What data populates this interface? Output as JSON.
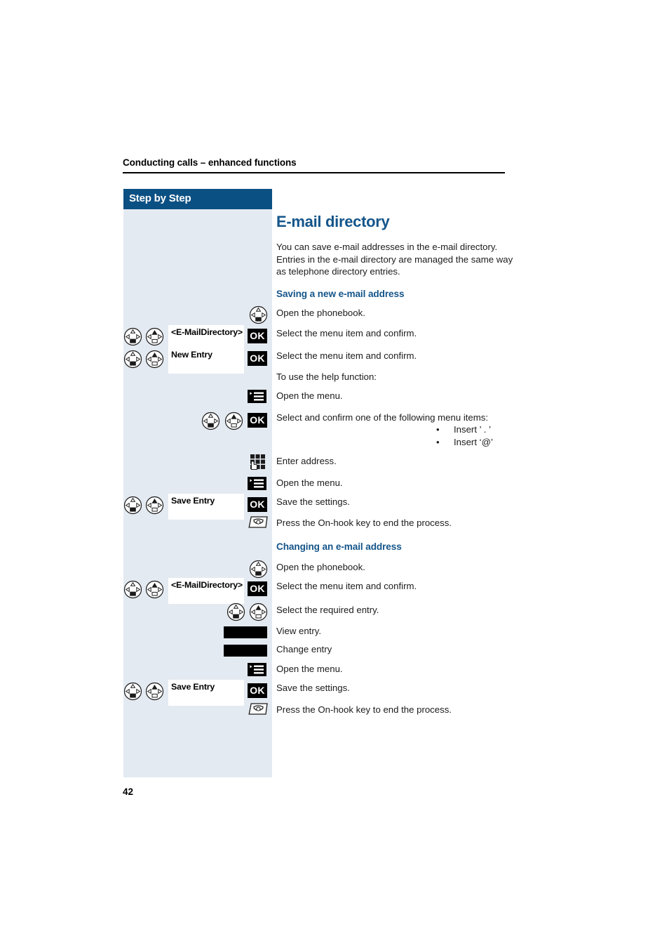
{
  "document": {
    "running_header": "Conducting calls – enhanced functions",
    "page_number": "42",
    "colors": {
      "accent_blue": "#14558a",
      "header_bar_blue": "#0b5083",
      "sidebar_bg": "#e4eaf1",
      "text": "#1b1b1b"
    }
  },
  "sidebar": {
    "title": "Step by Step"
  },
  "main": {
    "title": "E-mail directory",
    "intro": "You can save e-mail addresses in the e-mail directory. Entries in the e-mail directory are managed the same way as telephone directory entries.",
    "section_1": {
      "heading": "Saving a new e-mail address",
      "steps": [
        {
          "desc": "Open the phonebook."
        },
        {
          "display_label": "<E-MailDirectory>",
          "key_label": "OK",
          "desc": "Select the menu item and confirm."
        },
        {
          "display_label": "New Entry",
          "key_label": "OK",
          "desc": "Select the menu item and confirm."
        },
        {
          "desc": "To use the help function:"
        },
        {
          "desc": "Open the menu."
        },
        {
          "key_label": "OK",
          "desc": "Select and confirm one of the following menu items:",
          "bullets": [
            "Insert ’ . ’",
            "Insert ‘@’"
          ]
        },
        {
          "desc": "Enter address."
        },
        {
          "desc": "Open the menu."
        },
        {
          "display_label": "Save Entry",
          "key_label": "OK",
          "desc": "Save the settings."
        },
        {
          "desc": "Press the On-hook key to end the process."
        }
      ]
    },
    "section_2": {
      "heading": "Changing an e-mail address",
      "steps": [
        {
          "desc": "Open the phonebook."
        },
        {
          "display_label": "<E-MailDirectory>",
          "key_label": "OK",
          "desc": "Select the menu item and confirm."
        },
        {
          "desc": "Select the required entry."
        },
        {
          "desc": "View entry."
        },
        {
          "desc": "Change entry"
        },
        {
          "desc": "Open the menu."
        },
        {
          "display_label": "Save Entry",
          "key_label": "OK",
          "desc": "Save the settings."
        },
        {
          "desc": "Press the On-hook key to end the process."
        }
      ]
    }
  },
  "icons": {
    "navkey_square": "navigation-key-square-icon",
    "navkey_triangle": "navigation-key-triangle-icon",
    "phonebook": "phonebook-key-icon",
    "menu": "menu-key-icon",
    "keypad": "keypad-entry-icon",
    "onhook": "on-hook-key-icon",
    "blank_key": "blank-function-key"
  }
}
